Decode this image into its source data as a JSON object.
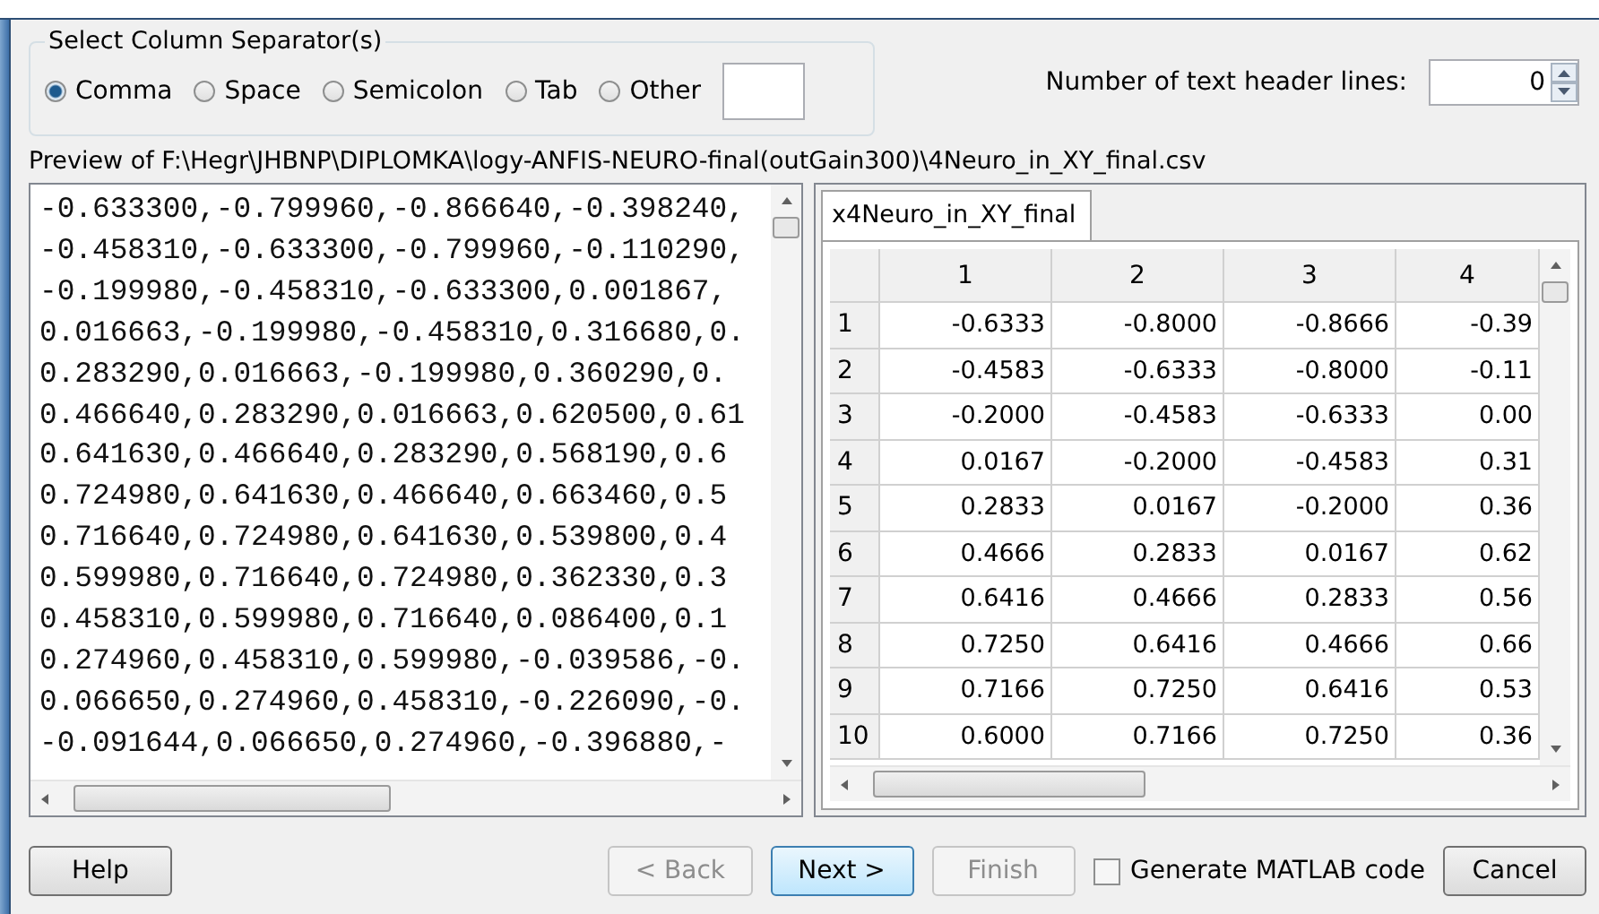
{
  "separators": {
    "title": "Select Column Separator(s)",
    "options": [
      {
        "label": "Comma",
        "selected": true
      },
      {
        "label": "Space",
        "selected": false
      },
      {
        "label": "Semicolon",
        "selected": false
      },
      {
        "label": "Tab",
        "selected": false
      },
      {
        "label": "Other",
        "selected": false
      }
    ]
  },
  "header_lines": {
    "label": "Number of text header lines:",
    "value": "0"
  },
  "preview": {
    "title": "Preview of F:\\Hegr\\JHBNP\\DIPLOMKA\\logy-ANFIS-NEURO-final(outGain300)\\4Neuro_in_XY_final.csv",
    "lines": [
      "-0.633300,-0.799960,-0.866640,-0.398240,",
      "-0.458310,-0.633300,-0.799960,-0.110290,",
      "-0.199980,-0.458310,-0.633300,0.001867,",
      "0.016663,-0.199980,-0.458310,0.316680,0.",
      "0.283290,0.016663,-0.199980,0.360290,0.",
      "0.466640,0.283290,0.016663,0.620500,0.61",
      "0.641630,0.466640,0.283290,0.568190,0.6",
      "0.724980,0.641630,0.466640,0.663460,0.5",
      "0.716640,0.724980,0.641630,0.539800,0.4",
      "0.599980,0.716640,0.724980,0.362330,0.3",
      "0.458310,0.599980,0.716640,0.086400,0.1",
      "0.274960,0.458310,0.599980,-0.039586,-0.",
      "0.066650,0.274960,0.458310,-0.226090,-0.",
      "-0.091644,0.066650,0.274960,-0.396880,-"
    ]
  },
  "table": {
    "tabs": [
      {
        "label": "x4Neuro_in_XY_final",
        "selected": true
      }
    ],
    "columns": [
      "1",
      "2",
      "3",
      "4"
    ],
    "rows": [
      {
        "header": "1",
        "cells": [
          "-0.6333",
          "-0.8000",
          "-0.8666",
          "-0.39"
        ]
      },
      {
        "header": "2",
        "cells": [
          "-0.4583",
          "-0.6333",
          "-0.8000",
          "-0.11"
        ]
      },
      {
        "header": "3",
        "cells": [
          "-0.2000",
          "-0.4583",
          "-0.6333",
          "0.00"
        ]
      },
      {
        "header": "4",
        "cells": [
          "0.0167",
          "-0.2000",
          "-0.4583",
          "0.31"
        ]
      },
      {
        "header": "5",
        "cells": [
          "0.2833",
          "0.0167",
          "-0.2000",
          "0.36"
        ]
      },
      {
        "header": "6",
        "cells": [
          "0.4666",
          "0.2833",
          "0.0167",
          "0.62"
        ]
      },
      {
        "header": "7",
        "cells": [
          "0.6416",
          "0.4666",
          "0.2833",
          "0.56"
        ]
      },
      {
        "header": "8",
        "cells": [
          "0.7250",
          "0.6416",
          "0.4666",
          "0.66"
        ]
      },
      {
        "header": "9",
        "cells": [
          "0.7166",
          "0.7250",
          "0.6416",
          "0.53"
        ]
      },
      {
        "header": "10",
        "cells": [
          "0.6000",
          "0.7166",
          "0.7250",
          "0.36"
        ]
      }
    ]
  },
  "footer": [
    {
      "kind": "button",
      "label": "Help",
      "disabled": false,
      "default": false
    },
    {
      "kind": "spacer"
    },
    {
      "kind": "button",
      "label": "< Back",
      "disabled": true,
      "default": false
    },
    {
      "kind": "button",
      "label": "Next >",
      "disabled": false,
      "default": true
    },
    {
      "kind": "button",
      "label": "Finish",
      "disabled": true,
      "default": false
    },
    {
      "kind": "checkbox",
      "label": "Generate MATLAB code",
      "checked": false
    },
    {
      "kind": "button",
      "label": "Cancel",
      "disabled": false,
      "default": false
    }
  ]
}
